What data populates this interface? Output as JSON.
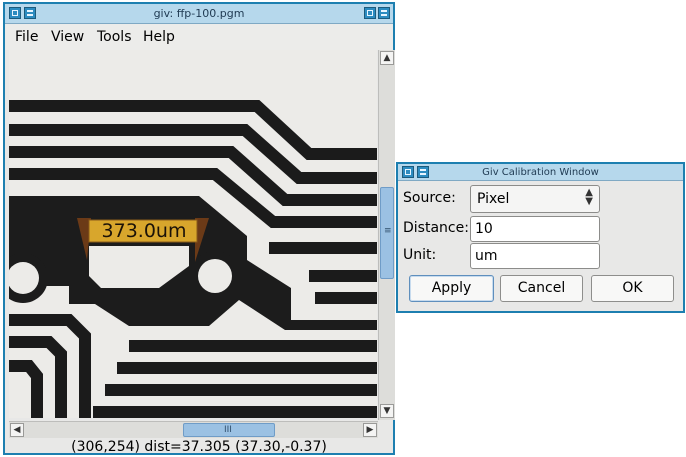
{
  "main_window": {
    "title": "giv: ffp-100.pgm",
    "menu": [
      "File",
      "View",
      "Tools",
      "Help"
    ],
    "measure_label": "373.0um",
    "status": "(306,254) dist=37.305 (37.30,-0.37)",
    "vscroll_grip": "≡",
    "hscroll_grip": "III"
  },
  "calibration_window": {
    "title": "Giv Calibration Window",
    "source_label": "Source:",
    "source_value": "Pixel",
    "distance_label": "Distance:",
    "distance_value": "10",
    "unit_label": "Unit:",
    "unit_value": "um",
    "apply_label": "Apply",
    "cancel_label": "Cancel",
    "ok_label": "OK"
  },
  "colors": {
    "window_border": "#1d7fb0",
    "titlebar": "#b6d8ec",
    "measure_fill": "#d8a62c",
    "measure_caliper": "#6b3a17"
  }
}
